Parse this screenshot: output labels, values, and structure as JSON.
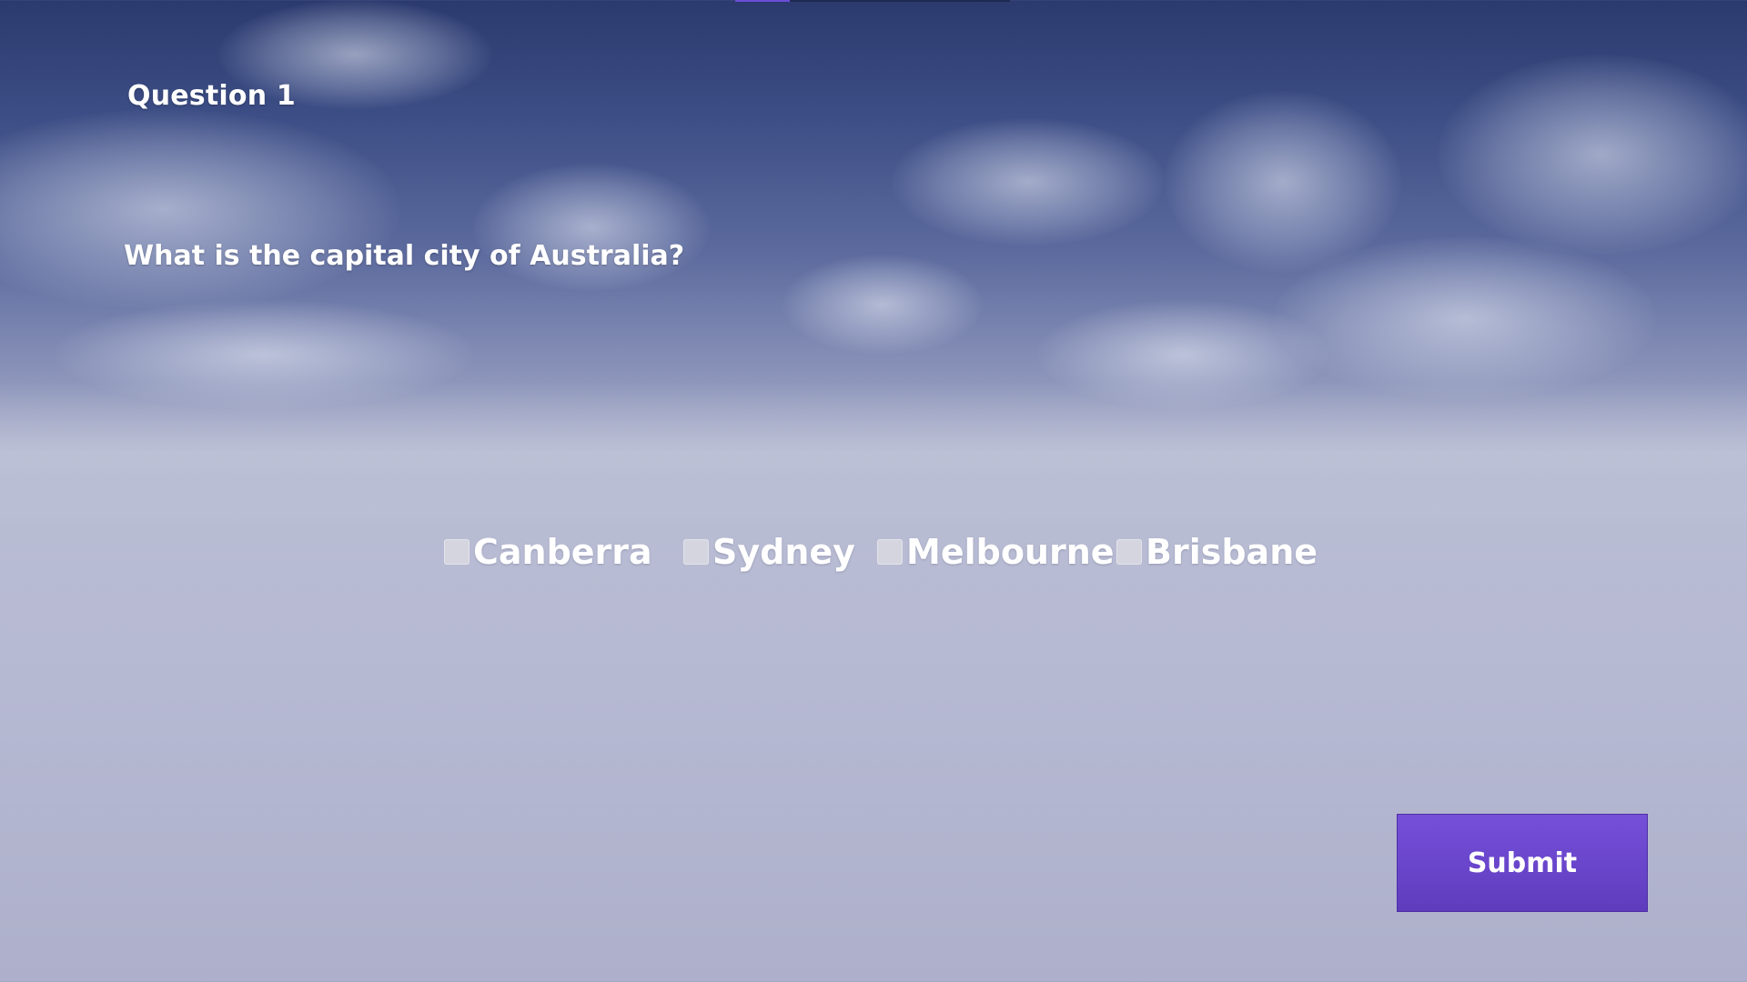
{
  "quiz": {
    "question_number": "Question 1",
    "question_text": "What is the capital city of Australia?",
    "options": [
      {
        "label": "Canberra",
        "checked": false
      },
      {
        "label": "Sydney",
        "checked": false
      },
      {
        "label": "Melbourne",
        "checked": false
      },
      {
        "label": "Brisbane",
        "checked": false
      }
    ],
    "submit_label": "Submit"
  },
  "colors": {
    "button_accent": "#6a46cc",
    "checkbox": "#d4d5df",
    "sky_top": "#2b3a6e",
    "sky_bottom": "#b6b9d2"
  }
}
